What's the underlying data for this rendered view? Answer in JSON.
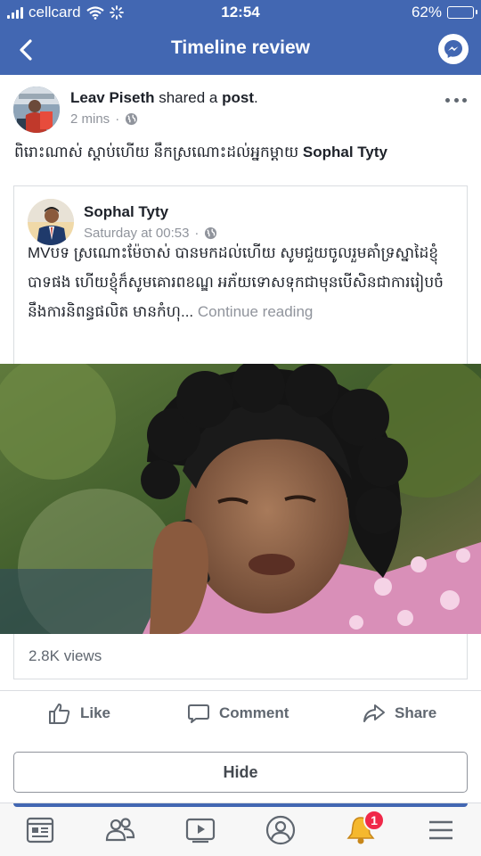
{
  "status_bar": {
    "carrier": "cellcard",
    "time": "12:54",
    "battery": "62%",
    "battery_level": 0.62
  },
  "header": {
    "title": "Timeline review"
  },
  "post": {
    "author": "Leav Piseth",
    "action_text": " shared a ",
    "object_text": "post",
    "punct": ".",
    "time": "2 mins",
    "caption_khmer": "ពិរោះណាស់ ស្ដាប់ហើយ នឹកស្រណោះដល់អ្នកម្ដាយ ",
    "caption_tag": "Sophal Tyty",
    "shared": {
      "author": "Sophal Tyty",
      "time": "Saturday at 00:53",
      "text": "MVបទ ស្រណោះម៉ែចាស់ បានមកដល់ហើយ សូមជួយចូលរួមគាំទ្រស្នាដៃខ្ញុំបាទផង ហើយខ្ញុំក៏សូមគោរពខណ្ឌ អភ័យទោសទុកជាមុនបើសិនជាការរៀបចំនឹងការនិពន្ធផលិត មានកំហុ...",
      "continue": " Continue reading",
      "views": "2.8K views"
    }
  },
  "actions": {
    "like": "Like",
    "comment": "Comment",
    "share": "Share"
  },
  "hide_button": "Hide",
  "tabbar": {
    "notification_count": "1"
  },
  "colors": {
    "brand": "#4267b2",
    "badge": "#f02849",
    "muted": "#90949c"
  }
}
